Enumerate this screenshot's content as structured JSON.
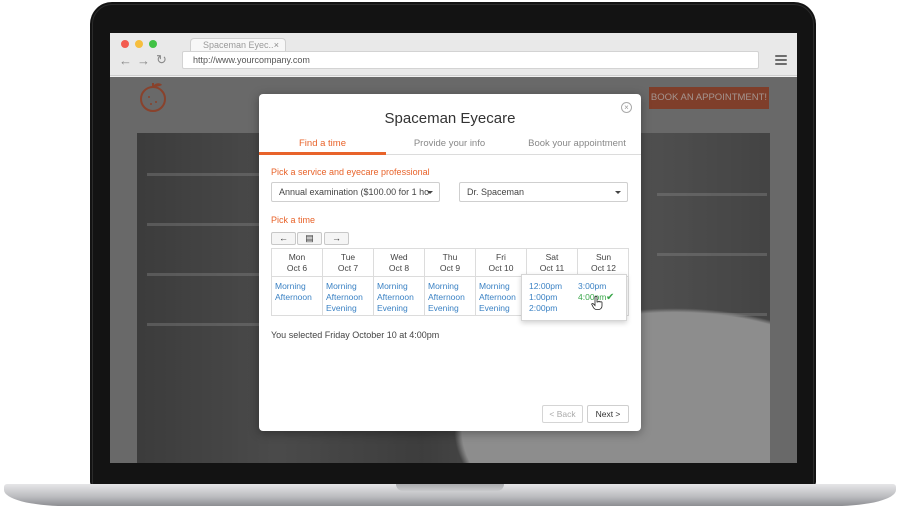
{
  "browser": {
    "tab_title": "Spaceman Eyec..",
    "tab_close": "×",
    "url": "http://www.yourcompany.com",
    "back_icon": "arrow-left-icon",
    "forward_icon": "arrow-right-icon",
    "reload_icon": "reload-icon"
  },
  "site": {
    "book_button": "BOOK AN APPOINTMENT!",
    "accent_color": "#b6401c"
  },
  "modal": {
    "title": "Spaceman Eyecare",
    "close": "×",
    "steps": [
      "Find a time",
      "Provide your info",
      "Book your appointment"
    ],
    "active_step": 0,
    "service_label": "Pick a service and eyecare professional",
    "service_value": "Annual examination ($100.00 for 1 ho",
    "professional_value": "Dr. Spaceman",
    "time_label": "Pick a time",
    "nav": {
      "prev": "←",
      "list": "▤",
      "next": "→"
    },
    "days": [
      {
        "name": "Mon",
        "date": "Oct 6",
        "slots": [
          "Morning",
          "Afternoon"
        ]
      },
      {
        "name": "Tue",
        "date": "Oct 7",
        "slots": [
          "Morning",
          "Afternoon",
          "Evening"
        ]
      },
      {
        "name": "Wed",
        "date": "Oct 8",
        "slots": [
          "Morning",
          "Afternoon",
          "Evening"
        ]
      },
      {
        "name": "Thu",
        "date": "Oct 9",
        "slots": [
          "Morning",
          "Afternoon",
          "Evening"
        ]
      },
      {
        "name": "Fri",
        "date": "Oct 10",
        "slots": [
          "Morning",
          "Afternoon",
          "Evening"
        ]
      },
      {
        "name": "Sat",
        "date": "Oct 11",
        "slots": []
      },
      {
        "name": "Sun",
        "date": "Oct 12",
        "slots": []
      }
    ],
    "popup_times": [
      "12:00pm",
      "1:00pm",
      "2:00pm",
      "3:00pm",
      "4:00pm"
    ],
    "selected_time": "4:00pm",
    "check": "✔",
    "selected_text": "You selected Friday October 10 at 4:00pm",
    "back_button": "< Back",
    "next_button": "Next >",
    "accent_color": "#e8632a",
    "link_color": "#3b82c4",
    "selected_color": "#3aa64a"
  }
}
